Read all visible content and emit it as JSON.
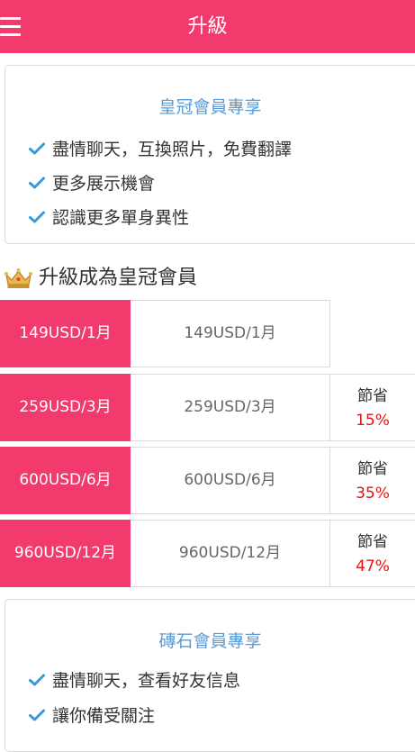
{
  "header": {
    "title": "升級",
    "menu_icon": "hamburger-menu-icon"
  },
  "crown_card": {
    "title": "皇冠會員專享",
    "benefits": [
      "盡情聊天，互換照片，免費翻譯",
      "更多展示機會",
      "認識更多單身異性"
    ]
  },
  "upgrade_section": {
    "icon": "crown-icon",
    "heading": "升級成為皇冠會員"
  },
  "plans": [
    {
      "tag": "149USD/1月",
      "price": "149USD/1月",
      "save_label": "",
      "save_pct": ""
    },
    {
      "tag": "259USD/3月",
      "price": "259USD/3月",
      "save_label": "節省",
      "save_pct": "15%"
    },
    {
      "tag": "600USD/6月",
      "price": "600USD/6月",
      "save_label": "節省",
      "save_pct": "35%"
    },
    {
      "tag": "960USD/12月",
      "price": "960USD/12月",
      "save_label": "節省",
      "save_pct": "47%"
    }
  ],
  "diamond_card": {
    "title": "磚石會員專享",
    "benefits": [
      "盡情聊天，查看好友信息",
      "讓你備受關注"
    ]
  },
  "colors": {
    "brand_pink": "#f23a6d",
    "title_blue": "#5b9bd5",
    "check_blue": "#3a9ad9",
    "savings_red": "#e01414",
    "crown_gold": "#d9a23a"
  }
}
